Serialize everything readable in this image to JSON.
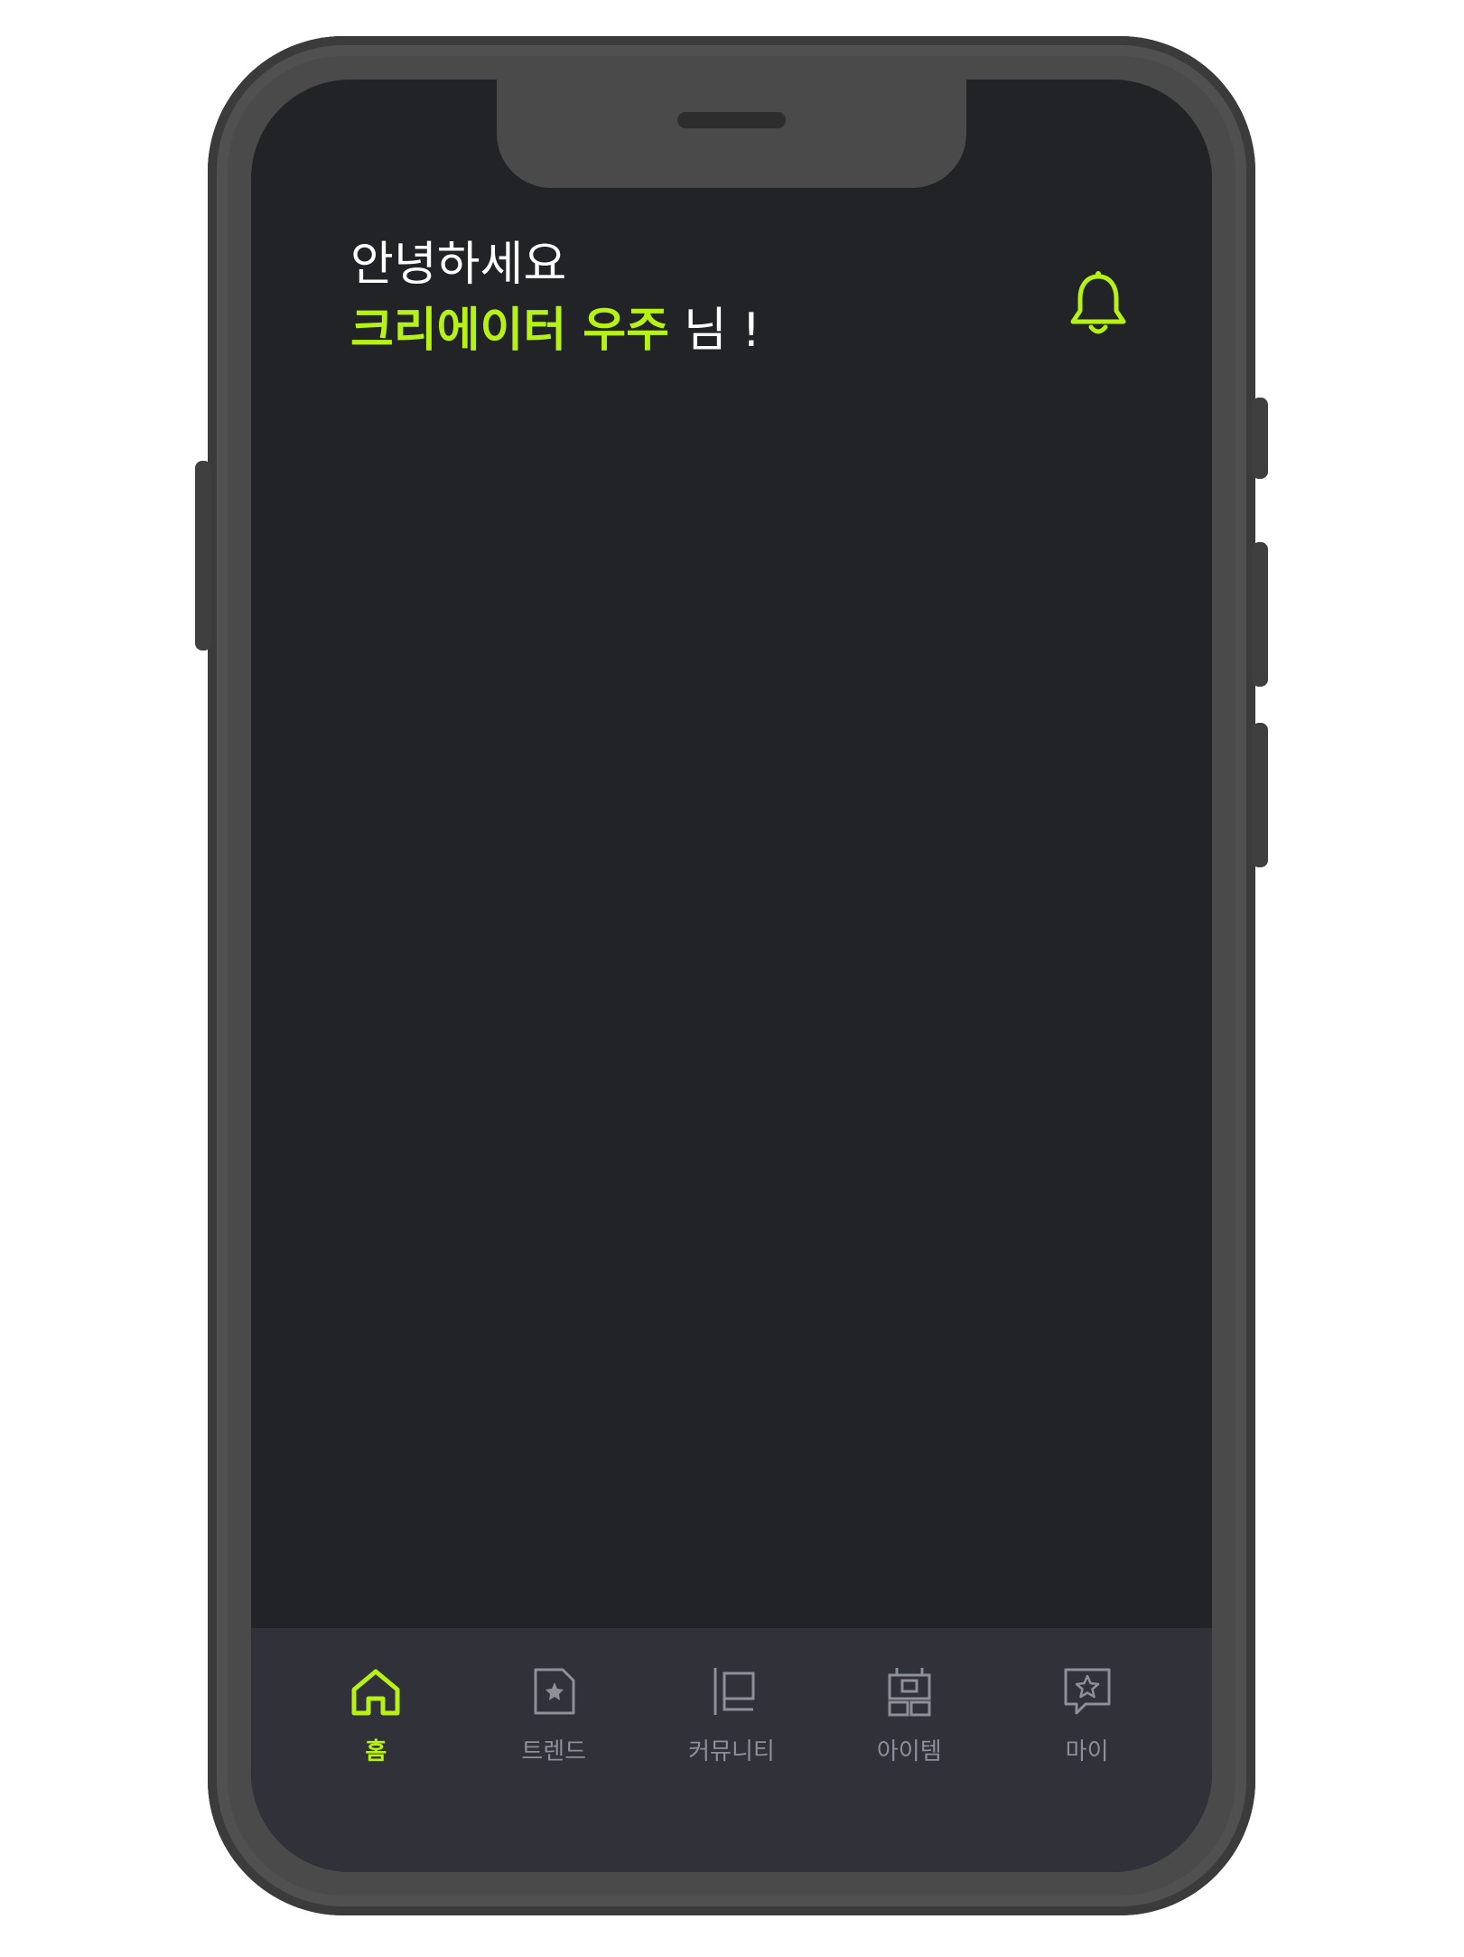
{
  "header": {
    "hello": "안녕하세요",
    "user_name": "크리에이터 우주",
    "name_suffix": "님 !",
    "notification_icon": "bell-icon"
  },
  "tabbar": {
    "items": [
      {
        "label": "홈",
        "icon": "home-icon",
        "active": true
      },
      {
        "label": "트렌드",
        "icon": "trend-icon",
        "active": false
      },
      {
        "label": "커뮤니티",
        "icon": "community-icon",
        "active": false
      },
      {
        "label": "아이템",
        "icon": "item-icon",
        "active": false
      },
      {
        "label": "마이",
        "icon": "my-icon",
        "active": false
      }
    ]
  },
  "colors": {
    "accent": "#b6f214",
    "screen_bg": "#222327",
    "tabbar_bg": "#303139",
    "inactive": "#8d8f99",
    "phone_frame": "#4a4a4a"
  }
}
